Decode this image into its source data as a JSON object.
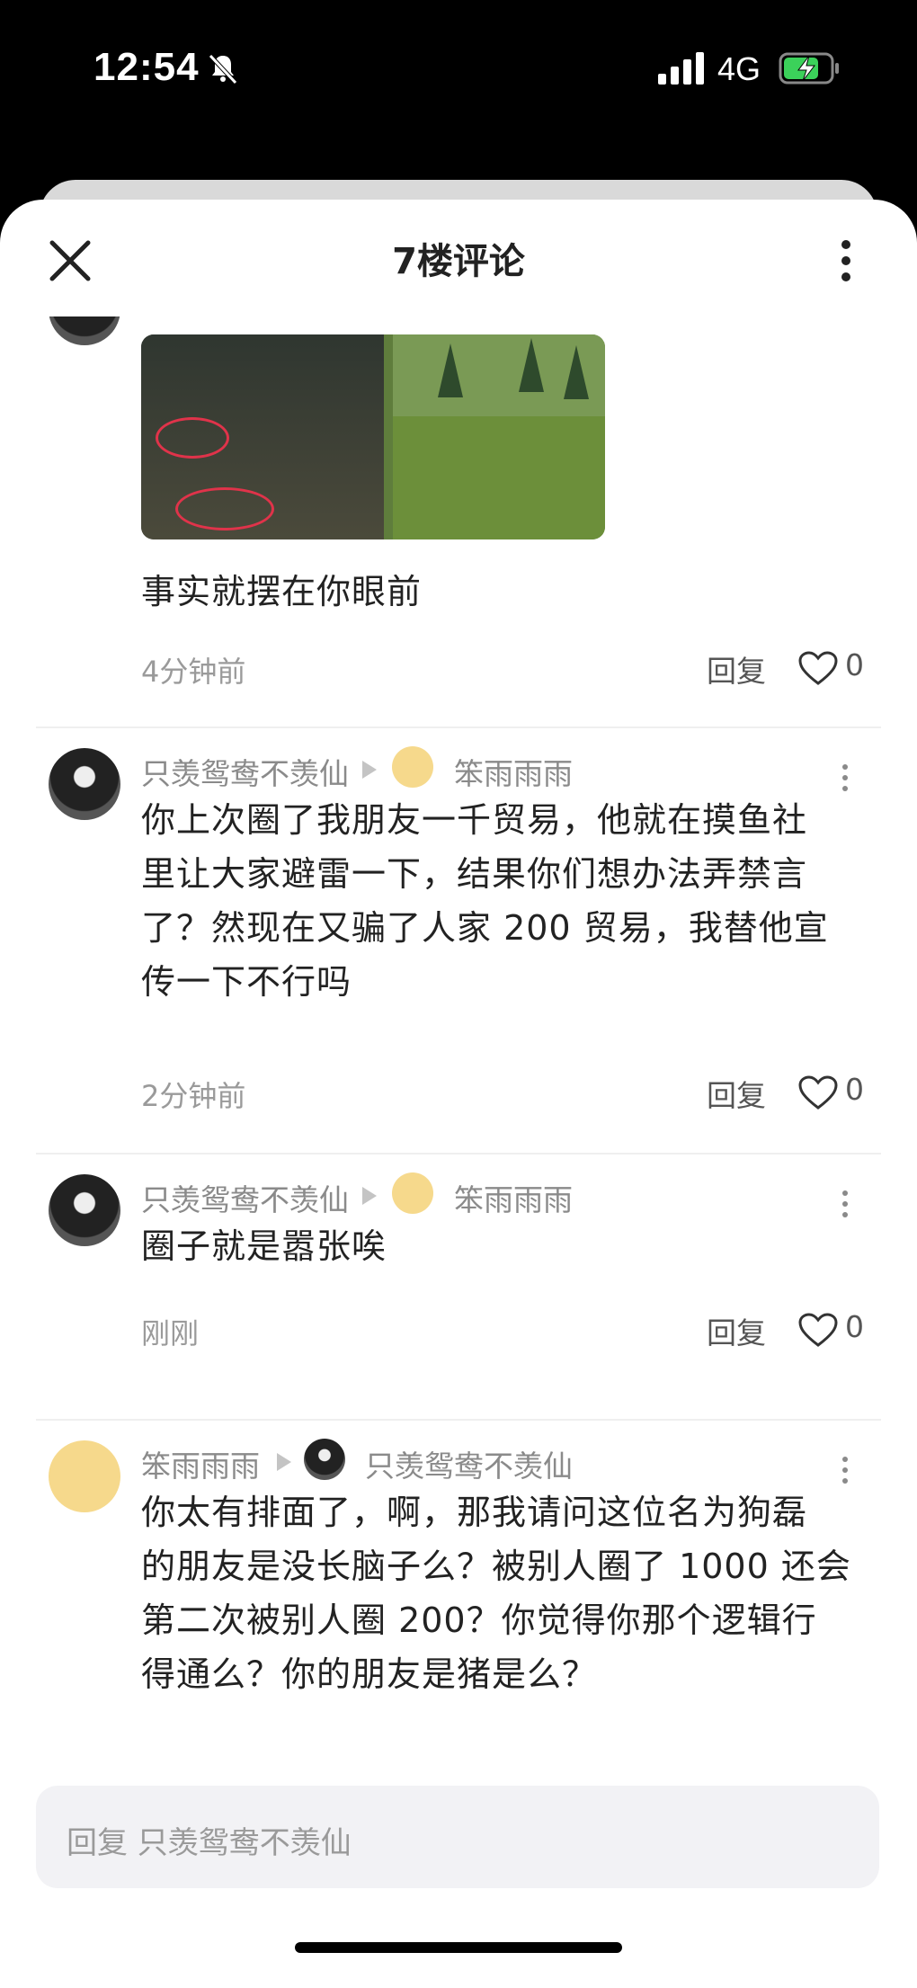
{
  "status_bar": {
    "time": "12:54",
    "network": "4G",
    "bell_muted": true,
    "battery_charging": true
  },
  "header": {
    "title": "7楼评论"
  },
  "comments": [
    {
      "text": "事实就摆在你眼前",
      "time": "4分钟前",
      "reply_label": "回复",
      "likes": "0",
      "has_image": true
    },
    {
      "author": "只羡鸳鸯不羡仙",
      "reply_to": "笨雨雨雨",
      "text_lines": [
        "你上次圈了我朋友一千贸易，他就在摸鱼社",
        "里让大家避雷一下，结果你们想办法弄禁言",
        "了？然现在又骗了人家 200 贸易，我替他宣",
        "传一下不行吗"
      ],
      "time": "2分钟前",
      "reply_label": "回复",
      "likes": "0"
    },
    {
      "author": "只羡鸳鸯不羡仙",
      "reply_to": "笨雨雨雨",
      "text": "圈子就是嚣张唉",
      "time": "刚刚",
      "reply_label": "回复",
      "likes": "0"
    },
    {
      "author": "笨雨雨雨",
      "reply_to": "只羡鸳鸯不羡仙",
      "text_lines": [
        "你太有排面了，啊，那我请问这位名为狗磊",
        "的朋友是没长脑子么？被别人圈了 1000 还会",
        "第二次被别人圈 200？你觉得你那个逻辑行",
        "得通么？你的朋友是猪是么？"
      ]
    }
  ],
  "reply_input": {
    "placeholder": "回复 只羡鸳鸯不羡仙"
  }
}
